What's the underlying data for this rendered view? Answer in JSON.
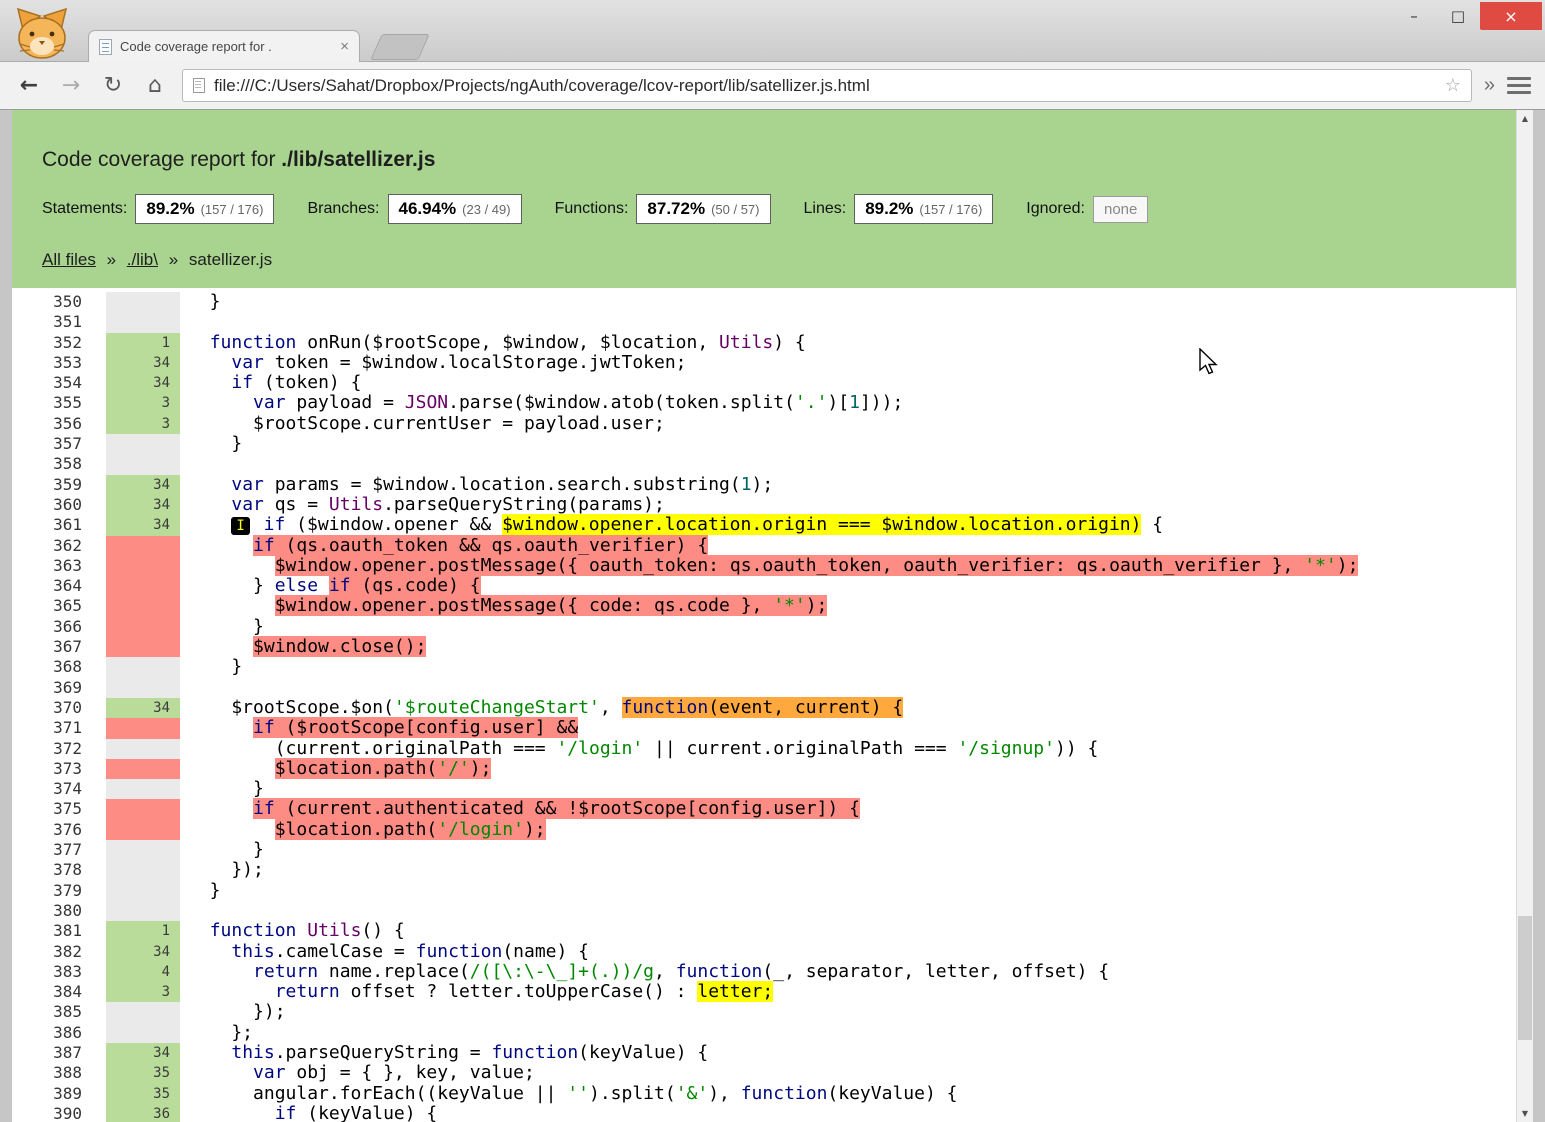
{
  "window_controls": {
    "minimize": "–",
    "maximize": "□",
    "close": "×"
  },
  "browser": {
    "tab_title": "Code coverage report for .",
    "tab_close": "×",
    "back": "←",
    "forward": "→",
    "reload": "↻",
    "home": "⌂",
    "url": "file:///C:/Users/Sahat/Dropbox/Projects/ngAuth/coverage/lcov-report/lib/satellizer.js.html",
    "bookmark_star": "☆",
    "overflow": "»",
    "scroll_up": "▲",
    "scroll_down": "▼"
  },
  "report": {
    "title_prefix": "Code coverage report for ",
    "title_file": "./lib/satellizer.js",
    "metrics": [
      {
        "label": "Statements:",
        "pct": "89.2%",
        "fraction": "(157 / 176)"
      },
      {
        "label": "Branches:",
        "pct": "46.94%",
        "fraction": "(23 / 49)"
      },
      {
        "label": "Functions:",
        "pct": "87.72%",
        "fraction": "(50 / 57)"
      },
      {
        "label": "Lines:",
        "pct": "89.2%",
        "fraction": "(157 / 176)"
      }
    ],
    "ignored_label": "Ignored:",
    "ignored_value": "none",
    "breadcrumb": {
      "all_files": "All files",
      "sep1": "»",
      "lib": "./lib\\",
      "sep2": "»",
      "file": "satellizer.js"
    }
  },
  "colors": {
    "header_green": "#A8D48F",
    "covered_green": "#B9DC9A",
    "uncovered_salmon": "#FC8C84",
    "branch_yellow": "#FFFF00",
    "function_orange": "#FFA83D"
  },
  "code": {
    "lines": [
      {
        "no": 350,
        "g": "neu",
        "count": "",
        "s": [
          {
            "t": "  }"
          }
        ]
      },
      {
        "no": 351,
        "g": "neu",
        "count": "",
        "s": []
      },
      {
        "no": 352,
        "g": "yes",
        "count": "1",
        "s": [
          {
            "t": "  "
          },
          {
            "t": "function",
            "c": "kwd"
          },
          {
            "t": " onRun($rootScope, $window, $location, "
          },
          {
            "t": "Utils",
            "c": "typ"
          },
          {
            "t": ") {"
          }
        ]
      },
      {
        "no": 353,
        "g": "yes",
        "count": "34",
        "s": [
          {
            "t": "    "
          },
          {
            "t": "var",
            "c": "kwd"
          },
          {
            "t": " token = $window.localStorage.jwtToken;"
          }
        ]
      },
      {
        "no": 354,
        "g": "yes",
        "count": "34",
        "s": [
          {
            "t": "    "
          },
          {
            "t": "if",
            "c": "kwd"
          },
          {
            "t": " (token) {"
          }
        ]
      },
      {
        "no": 355,
        "g": "yes",
        "count": "3",
        "s": [
          {
            "t": "      "
          },
          {
            "t": "var",
            "c": "kwd"
          },
          {
            "t": " payload = "
          },
          {
            "t": "JSON",
            "c": "typ"
          },
          {
            "t": ".parse($window.atob(token.split("
          },
          {
            "t": "'.'",
            "c": "str"
          },
          {
            "t": ")["
          },
          {
            "t": "1",
            "c": "lit"
          },
          {
            "t": "]));"
          }
        ]
      },
      {
        "no": 356,
        "g": "yes",
        "count": "3",
        "s": [
          {
            "t": "      $rootScope.currentUser = payload.user;"
          }
        ]
      },
      {
        "no": 357,
        "g": "neu",
        "count": "",
        "s": [
          {
            "t": "    }"
          }
        ]
      },
      {
        "no": 358,
        "g": "neu",
        "count": "",
        "s": []
      },
      {
        "no": 359,
        "g": "yes",
        "count": "34",
        "s": [
          {
            "t": "    "
          },
          {
            "t": "var",
            "c": "kwd"
          },
          {
            "t": " params = $window.location.search.substring("
          },
          {
            "t": "1",
            "c": "lit"
          },
          {
            "t": ");"
          }
        ]
      },
      {
        "no": 360,
        "g": "yes",
        "count": "34",
        "s": [
          {
            "t": "    "
          },
          {
            "t": "var",
            "c": "kwd"
          },
          {
            "t": " qs = "
          },
          {
            "t": "Utils",
            "c": "typ"
          },
          {
            "t": ".parseQueryString(params);"
          }
        ]
      },
      {
        "no": 361,
        "g": "yes",
        "count": "34",
        "s": [
          {
            "t": "    "
          },
          {
            "m": "I"
          },
          {
            "t": " "
          },
          {
            "t": "if",
            "c": "kwd"
          },
          {
            "t": " ($window.opener && "
          },
          {
            "t": "$window.opener.location.origin === $window.location.origin)",
            "bg": "branch"
          },
          {
            "t": " {"
          }
        ]
      },
      {
        "no": 362,
        "g": "no",
        "count": "",
        "s": [
          {
            "t": "      "
          },
          {
            "t": "if",
            "c": "kwd",
            "bg": "stmt"
          },
          {
            "t": " (qs.oauth_token && qs.oauth_verifier) {",
            "bg": "stmt"
          }
        ]
      },
      {
        "no": 363,
        "g": "no",
        "count": "",
        "s": [
          {
            "t": "        "
          },
          {
            "t": "$window.opener.postMessage({ oauth_token: qs.oauth_token, oauth_verifier: qs.oauth_verifier }, ",
            "bg": "stmt"
          },
          {
            "t": "'*'",
            "c": "str",
            "bg": "stmt"
          },
          {
            "t": ");",
            "bg": "stmt"
          }
        ]
      },
      {
        "no": 364,
        "g": "no",
        "count": "",
        "s": [
          {
            "t": "      } "
          },
          {
            "t": "else",
            "c": "kwd"
          },
          {
            "t": " "
          },
          {
            "t": "if",
            "c": "kwd",
            "bg": "stmt"
          },
          {
            "t": " (qs.code) {",
            "bg": "stmt"
          }
        ]
      },
      {
        "no": 365,
        "g": "no",
        "count": "",
        "s": [
          {
            "t": "        "
          },
          {
            "t": "$window.opener.postMessage({ code: qs.code }, ",
            "bg": "stmt"
          },
          {
            "t": "'*'",
            "c": "str",
            "bg": "stmt"
          },
          {
            "t": ");",
            "bg": "stmt"
          }
        ]
      },
      {
        "no": 366,
        "g": "no",
        "count": "",
        "s": [
          {
            "t": "      }"
          }
        ]
      },
      {
        "no": 367,
        "g": "no",
        "count": "",
        "s": [
          {
            "t": "      "
          },
          {
            "t": "$window.close();",
            "bg": "stmt"
          }
        ]
      },
      {
        "no": 368,
        "g": "neu",
        "count": "",
        "s": [
          {
            "t": "    }"
          }
        ]
      },
      {
        "no": 369,
        "g": "neu",
        "count": "",
        "s": []
      },
      {
        "no": 370,
        "g": "yes",
        "count": "34",
        "s": [
          {
            "t": "    $rootScope.$on("
          },
          {
            "t": "'$routeChangeStart'",
            "c": "str"
          },
          {
            "t": ", "
          },
          {
            "t": "function",
            "c": "kwd",
            "bg": "func"
          },
          {
            "t": "(event, current) {",
            "bg": "func"
          }
        ]
      },
      {
        "no": 371,
        "g": "no",
        "count": "",
        "s": [
          {
            "t": "      "
          },
          {
            "t": "if",
            "c": "kwd",
            "bg": "stmt"
          },
          {
            "t": " ($rootScope[config.user] &&",
            "bg": "stmt"
          }
        ]
      },
      {
        "no": 372,
        "g": "neu",
        "count": "",
        "s": [
          {
            "t": "        (current.originalPath === "
          },
          {
            "t": "'/login'",
            "c": "str"
          },
          {
            "t": " || current.originalPath === "
          },
          {
            "t": "'/signup'",
            "c": "str"
          },
          {
            "t": ")) {"
          }
        ]
      },
      {
        "no": 373,
        "g": "no",
        "count": "",
        "s": [
          {
            "t": "        "
          },
          {
            "t": "$location.path(",
            "bg": "stmt"
          },
          {
            "t": "'/'",
            "c": "str",
            "bg": "stmt"
          },
          {
            "t": ");",
            "bg": "stmt"
          }
        ]
      },
      {
        "no": 374,
        "g": "neu",
        "count": "",
        "s": [
          {
            "t": "      }"
          }
        ]
      },
      {
        "no": 375,
        "g": "no",
        "count": "",
        "s": [
          {
            "t": "      "
          },
          {
            "t": "if",
            "c": "kwd",
            "bg": "stmt"
          },
          {
            "t": " (current.authenticated && !$rootScope[config.user]) {",
            "bg": "stmt"
          }
        ]
      },
      {
        "no": 376,
        "g": "no",
        "count": "",
        "s": [
          {
            "t": "        "
          },
          {
            "t": "$location.path(",
            "bg": "stmt"
          },
          {
            "t": "'/login'",
            "c": "str",
            "bg": "stmt"
          },
          {
            "t": ");",
            "bg": "stmt"
          }
        ]
      },
      {
        "no": 377,
        "g": "neu",
        "count": "",
        "s": [
          {
            "t": "      }"
          }
        ]
      },
      {
        "no": 378,
        "g": "neu",
        "count": "",
        "s": [
          {
            "t": "    });"
          }
        ]
      },
      {
        "no": 379,
        "g": "neu",
        "count": "",
        "s": [
          {
            "t": "  }"
          }
        ]
      },
      {
        "no": 380,
        "g": "neu",
        "count": "",
        "s": []
      },
      {
        "no": 381,
        "g": "yes",
        "count": "1",
        "s": [
          {
            "t": "  "
          },
          {
            "t": "function",
            "c": "kwd"
          },
          {
            "t": " "
          },
          {
            "t": "Utils",
            "c": "typ"
          },
          {
            "t": "() {"
          }
        ]
      },
      {
        "no": 382,
        "g": "yes",
        "count": "34",
        "s": [
          {
            "t": "    "
          },
          {
            "t": "this",
            "c": "kwd"
          },
          {
            "t": ".camelCase = "
          },
          {
            "t": "function",
            "c": "kwd"
          },
          {
            "t": "(name) {"
          }
        ]
      },
      {
        "no": 383,
        "g": "yes",
        "count": "4",
        "s": [
          {
            "t": "      "
          },
          {
            "t": "return",
            "c": "kwd"
          },
          {
            "t": " name.replace("
          },
          {
            "t": "/([\\:\\-\\_]+(.))/g",
            "c": "str"
          },
          {
            "t": ", "
          },
          {
            "t": "function",
            "c": "kwd"
          },
          {
            "t": "(_, separator, letter, offset) {"
          }
        ]
      },
      {
        "no": 384,
        "g": "yes",
        "count": "3",
        "s": [
          {
            "t": "        "
          },
          {
            "t": "return",
            "c": "kwd"
          },
          {
            "t": " offset ? letter.toUpperCase() : "
          },
          {
            "t": "letter;",
            "bg": "branch"
          }
        ]
      },
      {
        "no": 385,
        "g": "neu",
        "count": "",
        "s": [
          {
            "t": "      });"
          }
        ]
      },
      {
        "no": 386,
        "g": "neu",
        "count": "",
        "s": [
          {
            "t": "    };"
          }
        ]
      },
      {
        "no": 387,
        "g": "yes",
        "count": "34",
        "s": [
          {
            "t": "    "
          },
          {
            "t": "this",
            "c": "kwd"
          },
          {
            "t": ".parseQueryString = "
          },
          {
            "t": "function",
            "c": "kwd"
          },
          {
            "t": "(keyValue) {"
          }
        ]
      },
      {
        "no": 388,
        "g": "yes",
        "count": "35",
        "s": [
          {
            "t": "      "
          },
          {
            "t": "var",
            "c": "kwd"
          },
          {
            "t": " obj = { }, key, value;"
          }
        ]
      },
      {
        "no": 389,
        "g": "yes",
        "count": "35",
        "s": [
          {
            "t": "      angular.forEach((keyValue || "
          },
          {
            "t": "''",
            "c": "str"
          },
          {
            "t": ").split("
          },
          {
            "t": "'&'",
            "c": "str"
          },
          {
            "t": "), "
          },
          {
            "t": "function",
            "c": "kwd"
          },
          {
            "t": "(keyValue) {"
          }
        ]
      },
      {
        "no": 390,
        "g": "yes",
        "count": "36",
        "s": [
          {
            "t": "        "
          },
          {
            "t": "if",
            "c": "kwd"
          },
          {
            "t": " (keyValue) {"
          }
        ]
      }
    ]
  }
}
